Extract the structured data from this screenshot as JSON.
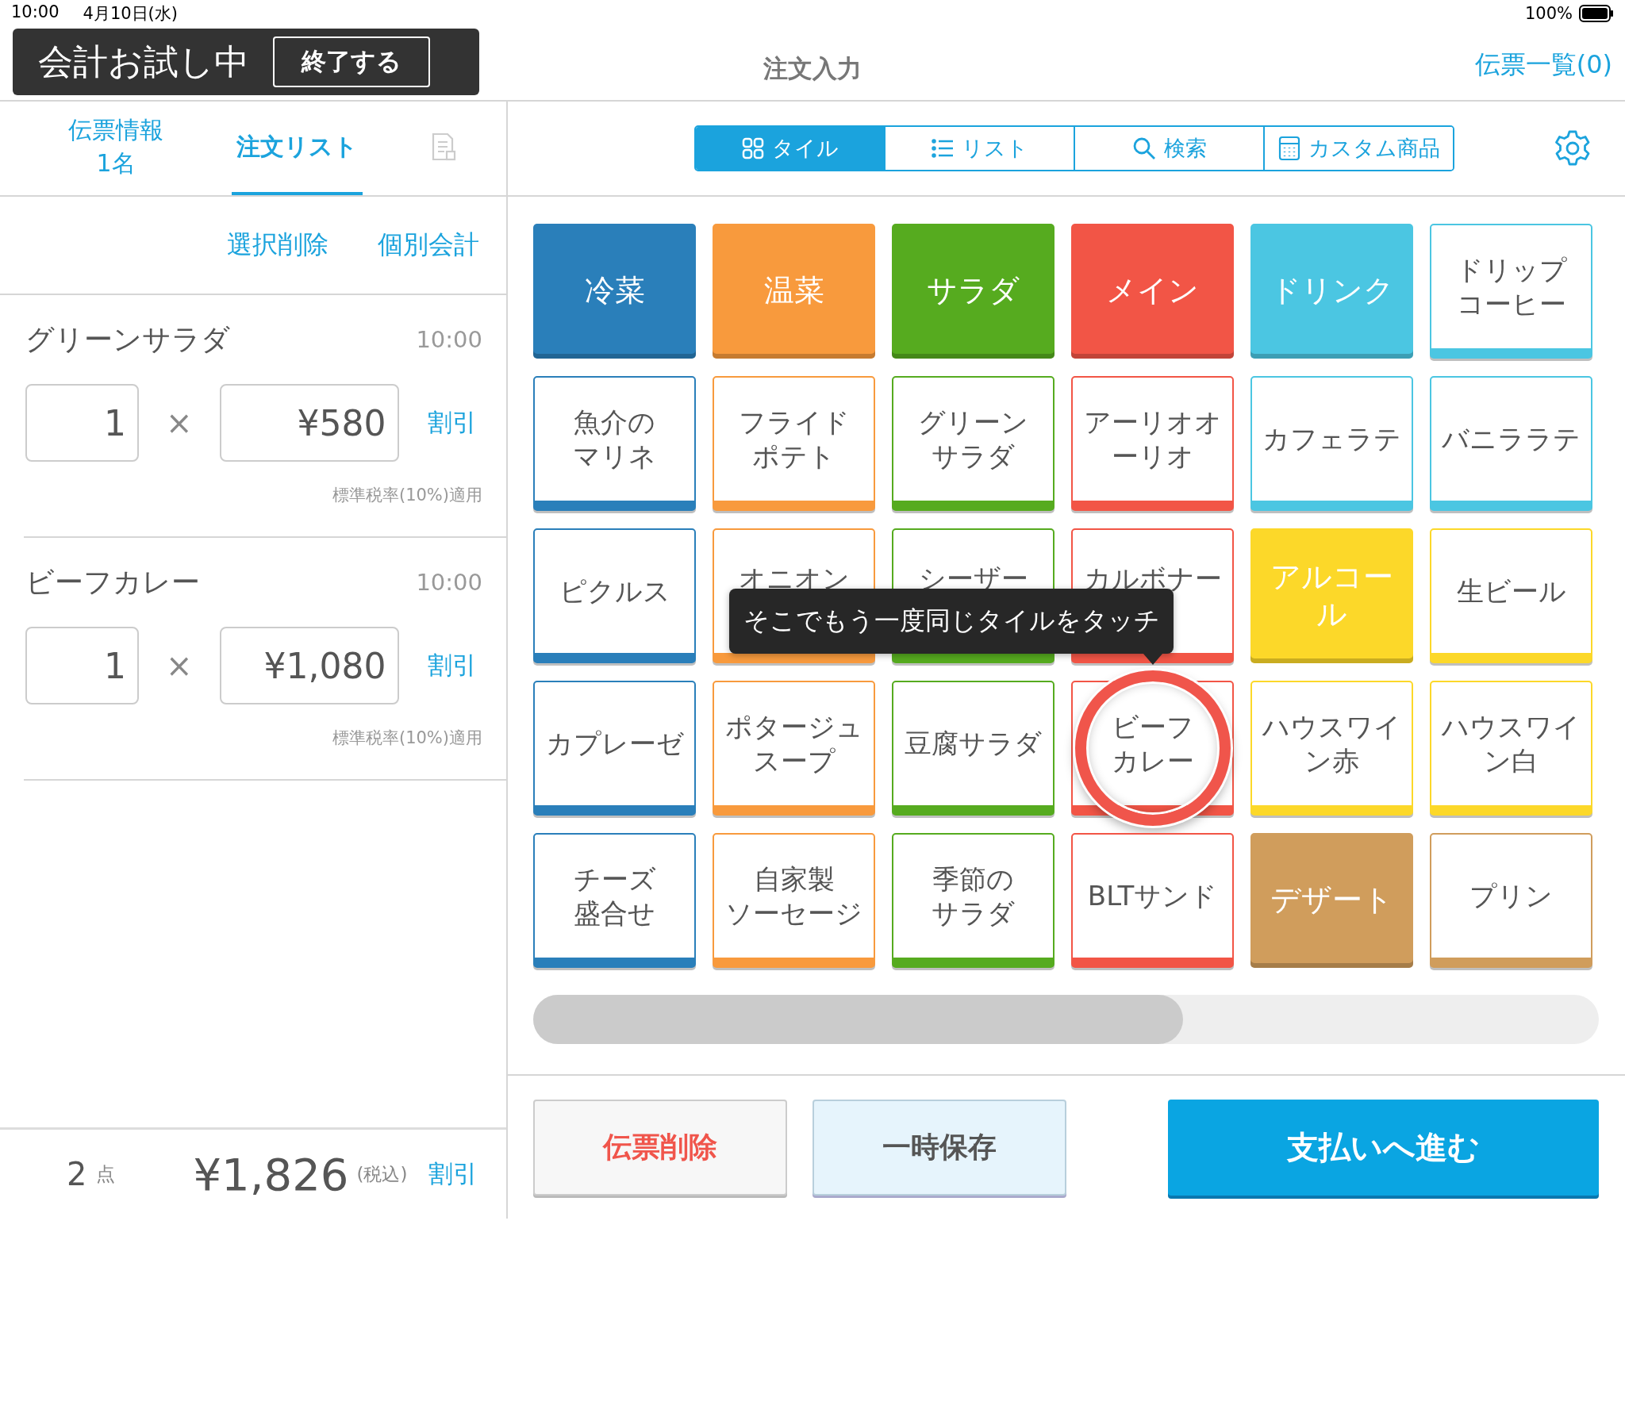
{
  "status_bar": {
    "time": "10:00",
    "date": "4月10日(水)",
    "battery": "100%"
  },
  "trial_banner": {
    "label": "会計お試し中",
    "button": "終了する"
  },
  "header": {
    "title": "注文入力",
    "right_link": "伝票一覧(0)"
  },
  "order_tabs": [
    {
      "kind": "text",
      "label": "伝票情報",
      "sublabel": "1名",
      "selected": false
    },
    {
      "kind": "text",
      "label": "注文リスト",
      "selected": true
    },
    {
      "kind": "icon",
      "disabled": true,
      "selected": false
    }
  ],
  "order_actions": [
    "選択削除",
    "個別会計"
  ],
  "orders": [
    {
      "name": "グリーンサラダ",
      "time": "10:00",
      "quantity": "1",
      "times": "×",
      "price": "¥580",
      "discount": "割引",
      "tax_note": "標準税率(10%)適用"
    },
    {
      "name": "ビーフカレー",
      "time": "10:00",
      "quantity": "1",
      "times": "×",
      "price": "¥1,080",
      "discount": "割引",
      "tax_note": "標準税率(10%)適用"
    }
  ],
  "order_footer": {
    "count": "2",
    "count_unit": "点",
    "total": "¥1,826",
    "tax_label": "(税込)",
    "discount": "割引"
  },
  "view_modes": [
    {
      "label": "タイル",
      "selected": true
    },
    {
      "label": "リスト",
      "selected": false
    },
    {
      "label": "検索",
      "selected": false
    },
    {
      "label": "カスタム商品",
      "selected": false
    }
  ],
  "tiles": [
    {
      "kind": "category",
      "lines": [
        "冷菜"
      ],
      "color": "#2a7fba",
      "touched": false
    },
    {
      "kind": "category",
      "lines": [
        "温菜"
      ],
      "color": "#f89a3d",
      "touched": false
    },
    {
      "kind": "category",
      "lines": [
        "サラダ"
      ],
      "color": "#56ab1f",
      "touched": false
    },
    {
      "kind": "category",
      "lines": [
        "メイン"
      ],
      "color": "#f25546",
      "touched": false
    },
    {
      "kind": "category",
      "lines": [
        "ドリンク"
      ],
      "color": "#4bc6e2",
      "touched": false
    },
    {
      "kind": "item",
      "lines": [
        "ドリップ",
        "コーヒー"
      ],
      "color": "#4bc6e2",
      "touched": false
    },
    {
      "kind": "item",
      "lines": [
        "魚介の",
        "マリネ"
      ],
      "color": "#2a7fba",
      "touched": false
    },
    {
      "kind": "item",
      "lines": [
        "フライド",
        "ポテト"
      ],
      "color": "#f89a3d",
      "touched": false
    },
    {
      "kind": "item",
      "lines": [
        "グリーン",
        "サラダ"
      ],
      "color": "#56ab1f",
      "touched": false
    },
    {
      "kind": "item",
      "lines": [
        "アーリオオ",
        "ーリオ"
      ],
      "color": "#f25546",
      "touched": false
    },
    {
      "kind": "item",
      "lines": [
        "カフェラテ"
      ],
      "color": "#4bc6e2",
      "touched": false
    },
    {
      "kind": "item",
      "lines": [
        "バニララテ"
      ],
      "color": "#4bc6e2",
      "touched": false
    },
    {
      "kind": "item",
      "lines": [
        "ピクルス"
      ],
      "color": "#2a7fba",
      "touched": false
    },
    {
      "kind": "covered",
      "lines": [
        "オニオン"
      ],
      "color": "#f89a3d",
      "touched": false
    },
    {
      "kind": "covered",
      "lines": [
        "シーザー"
      ],
      "color": "#56ab1f",
      "touched": false
    },
    {
      "kind": "covered",
      "lines": [
        "カルボナー"
      ],
      "color": "#f25546",
      "touched": false
    },
    {
      "kind": "category",
      "lines": [
        "アルコー",
        "ル"
      ],
      "color": "#fcd829",
      "touched": false
    },
    {
      "kind": "item",
      "lines": [
        "生ビール"
      ],
      "color": "#fcd829",
      "touched": false
    },
    {
      "kind": "item",
      "lines": [
        "カプレーゼ"
      ],
      "color": "#2a7fba",
      "touched": false
    },
    {
      "kind": "item",
      "lines": [
        "ポタージュ",
        "スープ"
      ],
      "color": "#f89a3d",
      "touched": false
    },
    {
      "kind": "item",
      "lines": [
        "豆腐サラダ"
      ],
      "color": "#56ab1f",
      "touched": false
    },
    {
      "kind": "item",
      "lines": [
        "ビーフ",
        "カレー"
      ],
      "color": "#f25546",
      "touched": true
    },
    {
      "kind": "item",
      "lines": [
        "ハウスワイ",
        "ン赤"
      ],
      "color": "#fcd829",
      "touched": false
    },
    {
      "kind": "item",
      "lines": [
        "ハウスワイ",
        "ン白"
      ],
      "color": "#fcd829",
      "touched": false
    },
    {
      "kind": "item",
      "lines": [
        "チーズ",
        "盛合せ"
      ],
      "color": "#2a7fba",
      "touched": false
    },
    {
      "kind": "item",
      "lines": [
        "自家製",
        "ソーセージ"
      ],
      "color": "#f89a3d",
      "touched": false
    },
    {
      "kind": "item",
      "lines": [
        "季節の",
        "サラダ"
      ],
      "color": "#56ab1f",
      "touched": false
    },
    {
      "kind": "item",
      "lines": [
        "BLTサンド"
      ],
      "color": "#f25546",
      "touched": false
    },
    {
      "kind": "category",
      "lines": [
        "デザート"
      ],
      "color": "#d09d5c",
      "touched": false
    },
    {
      "kind": "item",
      "lines": [
        "プリン"
      ],
      "color": "#d09d5c",
      "touched": false
    }
  ],
  "tooltip": "そこでもう一度同じタイルをタッチ",
  "bottom_buttons": [
    {
      "kind": "danger",
      "label": "伝票削除"
    },
    {
      "kind": "secondary",
      "label": "一時保存"
    },
    {
      "kind": "primary",
      "label": "支払いへ進む"
    }
  ]
}
